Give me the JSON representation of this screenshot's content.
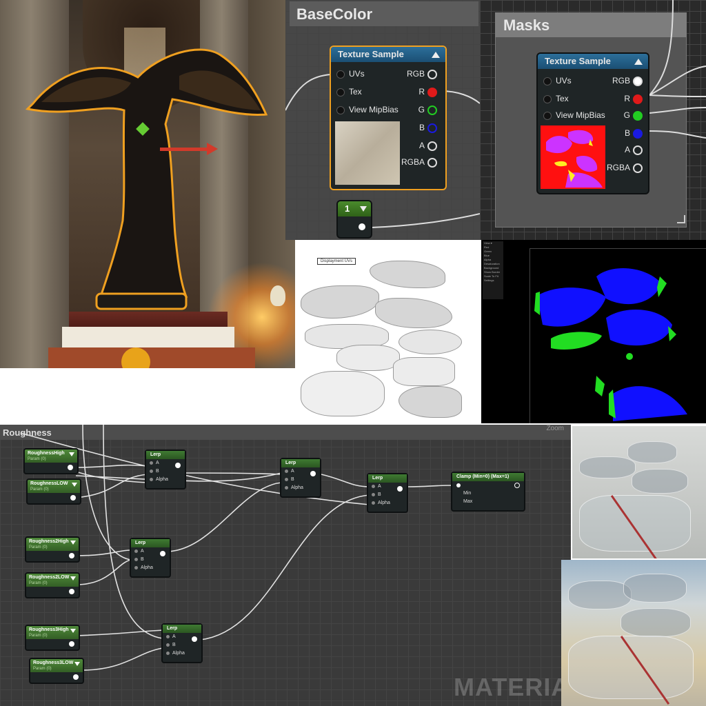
{
  "basecolor_comment": {
    "title": "BaseColor"
  },
  "basecolor_node": {
    "title": "Texture Sample",
    "inputs": [
      "UVs",
      "Tex",
      "View MipBias"
    ],
    "outputs": [
      "RGB",
      "R",
      "G",
      "B",
      "A",
      "RGBA"
    ]
  },
  "constant_node": {
    "value": "1"
  },
  "masks_comment": {
    "title": "Masks"
  },
  "masks_node": {
    "title": "Texture Sample",
    "inputs": [
      "UVs",
      "Tex",
      "View MipBias"
    ],
    "outputs": [
      "RGB",
      "R",
      "G",
      "B",
      "A",
      "RGBA"
    ]
  },
  "uv_sheet": {
    "label": "Displayment UVs"
  },
  "mask_viewer": {
    "menu_items": [
      "View ▾",
      "Red",
      "Green",
      "Blue",
      "Alpha",
      "Desaturation",
      "Background",
      "Show Border",
      "Scale To Fit",
      "Settings"
    ]
  },
  "roughness_comment": {
    "title": "Roughness",
    "zoom_label": "Zoom"
  },
  "roughness_params": [
    {
      "name": "RoughnessHigh",
      "sub": "Param (0)"
    },
    {
      "name": "RoughnessLOW",
      "sub": "Param (0)"
    },
    {
      "name": "Roughness2High",
      "sub": "Param (0)"
    },
    {
      "name": "Roughness2LOW",
      "sub": "Param (0)"
    },
    {
      "name": "Roughness3High",
      "sub": "Param (0)"
    },
    {
      "name": "Roughness3LOW",
      "sub": "Param (0)"
    }
  ],
  "lerp_node": {
    "title": "Lerp",
    "pins": [
      "A",
      "B",
      "Alpha"
    ]
  },
  "clamp_node": {
    "title": "Clamp (Min=0) (Max=1)",
    "pins": [
      "Min",
      "Max"
    ]
  },
  "watermark": "MATERIA",
  "colors": {
    "node_header_blue": "#2c6f9a",
    "param_green": "#4f8a3a",
    "pin_red": "#e01a1a",
    "pin_green": "#22cc22",
    "pin_blue": "#1a1ae0",
    "selection_orange": "#f0a020"
  }
}
